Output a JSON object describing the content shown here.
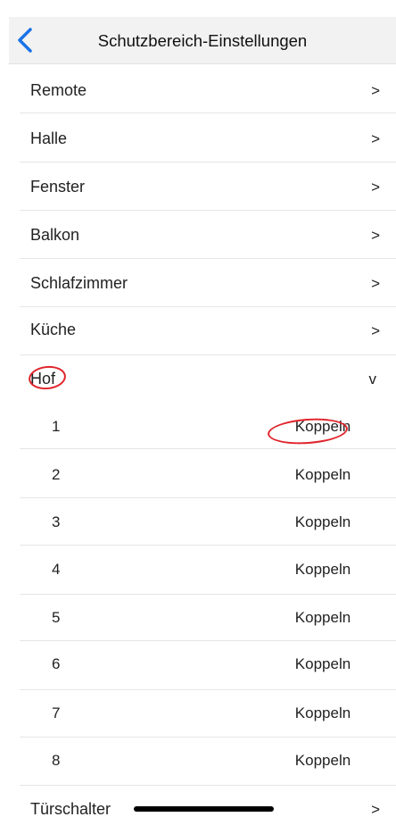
{
  "nav": {
    "title": "Schutzbereich-Einstellungen",
    "back_icon": "chevron-left-icon",
    "accent": "#1a73e8"
  },
  "zones": [
    {
      "label": "Remote",
      "indicator": ">"
    },
    {
      "label": "Halle",
      "indicator": ">"
    },
    {
      "label": "Fenster",
      "indicator": ">"
    },
    {
      "label": "Balkon",
      "indicator": ">"
    },
    {
      "label": "Schlafzimmer",
      "indicator": ">"
    },
    {
      "label": "Küche",
      "indicator": ">"
    },
    {
      "label": "Hof",
      "indicator": "v"
    }
  ],
  "hof_devices": [
    {
      "number": "1",
      "action": "Koppeln"
    },
    {
      "number": "2",
      "action": "Koppeln"
    },
    {
      "number": "3",
      "action": "Koppeln"
    },
    {
      "number": "4",
      "action": "Koppeln"
    },
    {
      "number": "5",
      "action": "Koppeln"
    },
    {
      "number": "6",
      "action": "Koppeln"
    },
    {
      "number": "7",
      "action": "Koppeln"
    },
    {
      "number": "8",
      "action": "Koppeln"
    }
  ],
  "last_zone": {
    "label": "Türschalter",
    "indicator": ">"
  },
  "annotation_color": "#e0242b"
}
